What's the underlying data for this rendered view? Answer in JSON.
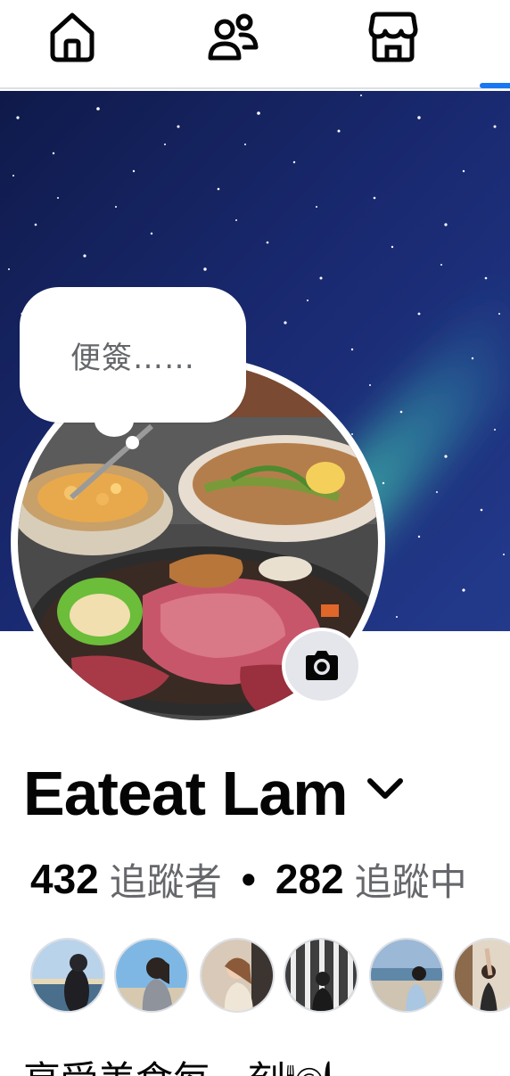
{
  "nav": {
    "items": [
      {
        "name": "home",
        "icon": "home-icon"
      },
      {
        "name": "friends",
        "icon": "friends-icon"
      },
      {
        "name": "marketplace",
        "icon": "marketplace-icon"
      }
    ],
    "accent": "#1877f2"
  },
  "cover": {
    "theme": "starry-night-aurora"
  },
  "note": {
    "text": "便簽……"
  },
  "profile": {
    "name": "Eateat Lam",
    "camera_icon": "camera-icon",
    "dropdown_icon": "chevron-down-icon"
  },
  "stats": {
    "followers_count": "432",
    "followers_label": "追蹤者",
    "separator": "•",
    "following_count": "282",
    "following_label": "追蹤中"
  },
  "friends": [
    {
      "name": "friend-1"
    },
    {
      "name": "friend-2"
    },
    {
      "name": "friend-3"
    },
    {
      "name": "friend-4"
    },
    {
      "name": "friend-5"
    },
    {
      "name": "friend-6"
    }
  ],
  "bio": {
    "text": "享受美食每一刻🍽"
  },
  "colors": {
    "primary_text": "#050505",
    "secondary_text": "#65676b",
    "divider": "#dcdfe4"
  }
}
